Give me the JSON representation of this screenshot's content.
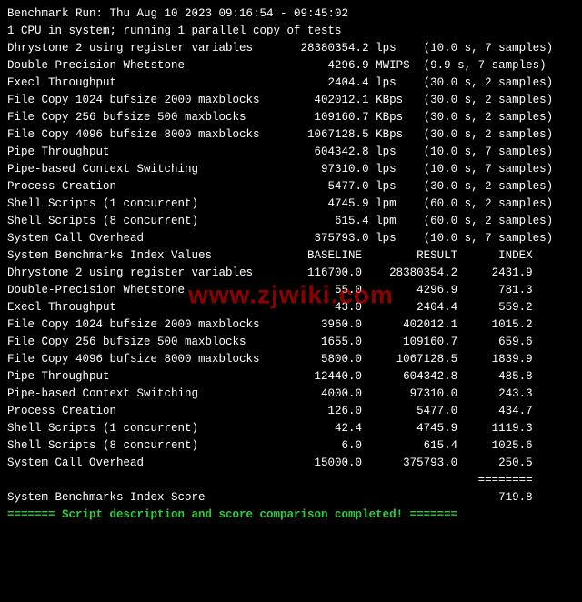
{
  "header": {
    "run_line": "Benchmark Run: Thu Aug 10 2023 09:16:54 - 09:45:02",
    "cpu_line": "1 CPU in system; running 1 parallel copy of tests"
  },
  "results": [
    {
      "name": "Dhrystone 2 using register variables",
      "value": "28380354.2",
      "unit": "lps",
      "time": "10.0",
      "samples": "7"
    },
    {
      "name": "Double-Precision Whetstone",
      "value": "4296.9",
      "unit": "MWIPS",
      "time": "9.9",
      "samples": "7"
    },
    {
      "name": "Execl Throughput",
      "value": "2404.4",
      "unit": "lps",
      "time": "30.0",
      "samples": "2"
    },
    {
      "name": "File Copy 1024 bufsize 2000 maxblocks",
      "value": "402012.1",
      "unit": "KBps",
      "time": "30.0",
      "samples": "2"
    },
    {
      "name": "File Copy 256 bufsize 500 maxblocks",
      "value": "109160.7",
      "unit": "KBps",
      "time": "30.0",
      "samples": "2"
    },
    {
      "name": "File Copy 4096 bufsize 8000 maxblocks",
      "value": "1067128.5",
      "unit": "KBps",
      "time": "30.0",
      "samples": "2"
    },
    {
      "name": "Pipe Throughput",
      "value": "604342.8",
      "unit": "lps",
      "time": "10.0",
      "samples": "7"
    },
    {
      "name": "Pipe-based Context Switching",
      "value": "97310.0",
      "unit": "lps",
      "time": "10.0",
      "samples": "7"
    },
    {
      "name": "Process Creation",
      "value": "5477.0",
      "unit": "lps",
      "time": "30.0",
      "samples": "2"
    },
    {
      "name": "Shell Scripts (1 concurrent)",
      "value": "4745.9",
      "unit": "lpm",
      "time": "60.0",
      "samples": "2"
    },
    {
      "name": "Shell Scripts (8 concurrent)",
      "value": "615.4",
      "unit": "lpm",
      "time": "60.0",
      "samples": "2"
    },
    {
      "name": "System Call Overhead",
      "value": "375793.0",
      "unit": "lps",
      "time": "10.0",
      "samples": "7"
    }
  ],
  "index_header": {
    "title": "System Benchmarks Index Values",
    "col_baseline": "BASELINE",
    "col_result": "RESULT",
    "col_index": "INDEX"
  },
  "index_rows": [
    {
      "name": "Dhrystone 2 using register variables",
      "baseline": "116700.0",
      "result": "28380354.2",
      "index": "2431.9"
    },
    {
      "name": "Double-Precision Whetstone",
      "baseline": "55.0",
      "result": "4296.9",
      "index": "781.3"
    },
    {
      "name": "Execl Throughput",
      "baseline": "43.0",
      "result": "2404.4",
      "index": "559.2"
    },
    {
      "name": "File Copy 1024 bufsize 2000 maxblocks",
      "baseline": "3960.0",
      "result": "402012.1",
      "index": "1015.2"
    },
    {
      "name": "File Copy 256 bufsize 500 maxblocks",
      "baseline": "1655.0",
      "result": "109160.7",
      "index": "659.6"
    },
    {
      "name": "File Copy 4096 bufsize 8000 maxblocks",
      "baseline": "5800.0",
      "result": "1067128.5",
      "index": "1839.9"
    },
    {
      "name": "Pipe Throughput",
      "baseline": "12440.0",
      "result": "604342.8",
      "index": "485.8"
    },
    {
      "name": "Pipe-based Context Switching",
      "baseline": "4000.0",
      "result": "97310.0",
      "index": "243.3"
    },
    {
      "name": "Process Creation",
      "baseline": "126.0",
      "result": "5477.0",
      "index": "434.7"
    },
    {
      "name": "Shell Scripts (1 concurrent)",
      "baseline": "42.4",
      "result": "4745.9",
      "index": "1119.3"
    },
    {
      "name": "Shell Scripts (8 concurrent)",
      "baseline": "6.0",
      "result": "615.4",
      "index": "1025.6"
    },
    {
      "name": "System Call Overhead",
      "baseline": "15000.0",
      "result": "375793.0",
      "index": "250.5"
    }
  ],
  "index_divider": "========",
  "score": {
    "label": "System Benchmarks Index Score",
    "value": "719.8"
  },
  "footer": {
    "sep": "=======",
    "msg": " Script description and score comparison completed! "
  },
  "watermark": "www.zjwiki.com"
}
